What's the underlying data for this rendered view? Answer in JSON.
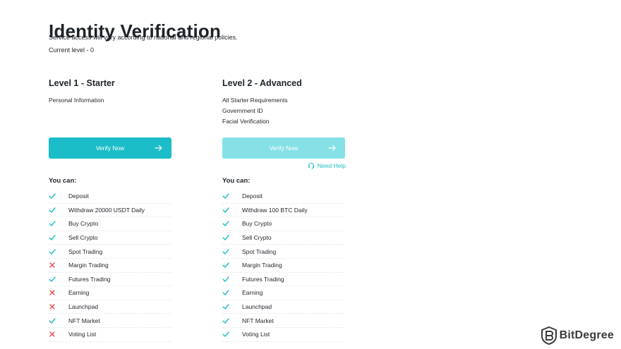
{
  "page": {
    "title": "Identity Verification",
    "subtitle": "Service access will vary according to national and regional policies.",
    "current_level": "Current level - 0"
  },
  "colors": {
    "accent": "#1bbdc9",
    "accent_disabled": "#86e1e7",
    "check": "#1bbdc9",
    "cross": "#e5484d"
  },
  "levels": [
    {
      "title": "Level 1 - Starter",
      "requirements": [
        "Personal Information"
      ],
      "button_label": "Verify Now",
      "button_enabled": true,
      "you_can_label": "You can:",
      "permissions": [
        {
          "label": "Deposit",
          "allowed": true
        },
        {
          "label": "Withdraw 20000 USDT Daily",
          "allowed": true
        },
        {
          "label": "Buy Crypto",
          "allowed": true
        },
        {
          "label": "Sell Crypto",
          "allowed": true
        },
        {
          "label": "Spot Trading",
          "allowed": true
        },
        {
          "label": "Margin Trading",
          "allowed": false
        },
        {
          "label": "Futures Trading",
          "allowed": true
        },
        {
          "label": "Earning",
          "allowed": false
        },
        {
          "label": "Launchpad",
          "allowed": false
        },
        {
          "label": "NFT Market",
          "allowed": true
        },
        {
          "label": "Voting List",
          "allowed": false
        }
      ]
    },
    {
      "title": "Level 2 - Advanced",
      "requirements": [
        "All Starter Requirements",
        "Government ID",
        "Facial Verification"
      ],
      "button_label": "Verify Now",
      "button_enabled": false,
      "need_help": "Need Help",
      "you_can_label": "You can:",
      "permissions": [
        {
          "label": "Deposit",
          "allowed": true
        },
        {
          "label": "Withdraw 100 BTC Daily",
          "allowed": true
        },
        {
          "label": "Buy Crypto",
          "allowed": true
        },
        {
          "label": "Sell Crypto",
          "allowed": true
        },
        {
          "label": "Spot Trading",
          "allowed": true
        },
        {
          "label": "Margin Trading",
          "allowed": true
        },
        {
          "label": "Futures Trading",
          "allowed": true
        },
        {
          "label": "Earning",
          "allowed": true
        },
        {
          "label": "Launchpad",
          "allowed": true
        },
        {
          "label": "NFT Market",
          "allowed": true
        },
        {
          "label": "Voting List",
          "allowed": true
        }
      ]
    }
  ],
  "watermark": {
    "text": "BitDegree",
    "icon": "bitdegree-logo-icon"
  }
}
